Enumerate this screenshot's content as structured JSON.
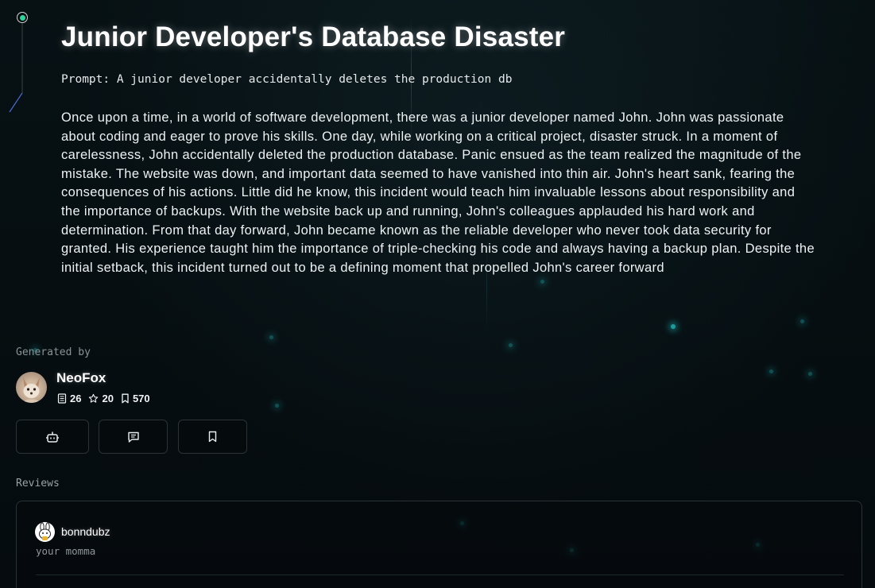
{
  "story": {
    "title": "Junior Developer's Database Disaster",
    "prompt": "Prompt: A junior developer accidentally deletes the production db",
    "body": "Once upon a time, in a world of software development, there was a junior developer named John. John was passionate about coding and eager to prove his skills. One day, while working on a critical project, disaster struck. In a moment of carelessness, John accidentally deleted the production database. Panic ensued as the team realized the magnitude of the mistake. The website was down, and important data seemed to have vanished into thin air. John's heart sank, fearing the consequences of his actions. Little did he know, this incident would teach him invaluable lessons about responsibility and the importance of backups. With the website back up and running, John's colleagues applauded his hard work and determination. From that day forward, John became known as the reliable developer who never took data security for granted. His experience taught him the importance of triple-checking his code and always having a backup plan. Despite the initial setback, this incident turned out to be a defining moment that propelled John's career forward"
  },
  "author": {
    "generated_by_label": "Generated by",
    "name": "NeoFox",
    "stats": {
      "stories": "26",
      "stars": "20",
      "bookmarks": "570"
    },
    "avatar_icon": "fox-avatar"
  },
  "actions": [
    {
      "icon": "bot-icon"
    },
    {
      "icon": "chat-icon"
    },
    {
      "icon": "bookmark-icon"
    }
  ],
  "reviews": {
    "label": "Reviews",
    "items": [
      {
        "user": "bonndubz",
        "text": "your momma",
        "avatar_icon": "bunny-avatar"
      }
    ]
  },
  "colors": {
    "background": "#050c0f",
    "accent_dot": "#2bd49a",
    "particle": "#23c9c9",
    "border": "#2b3336"
  }
}
